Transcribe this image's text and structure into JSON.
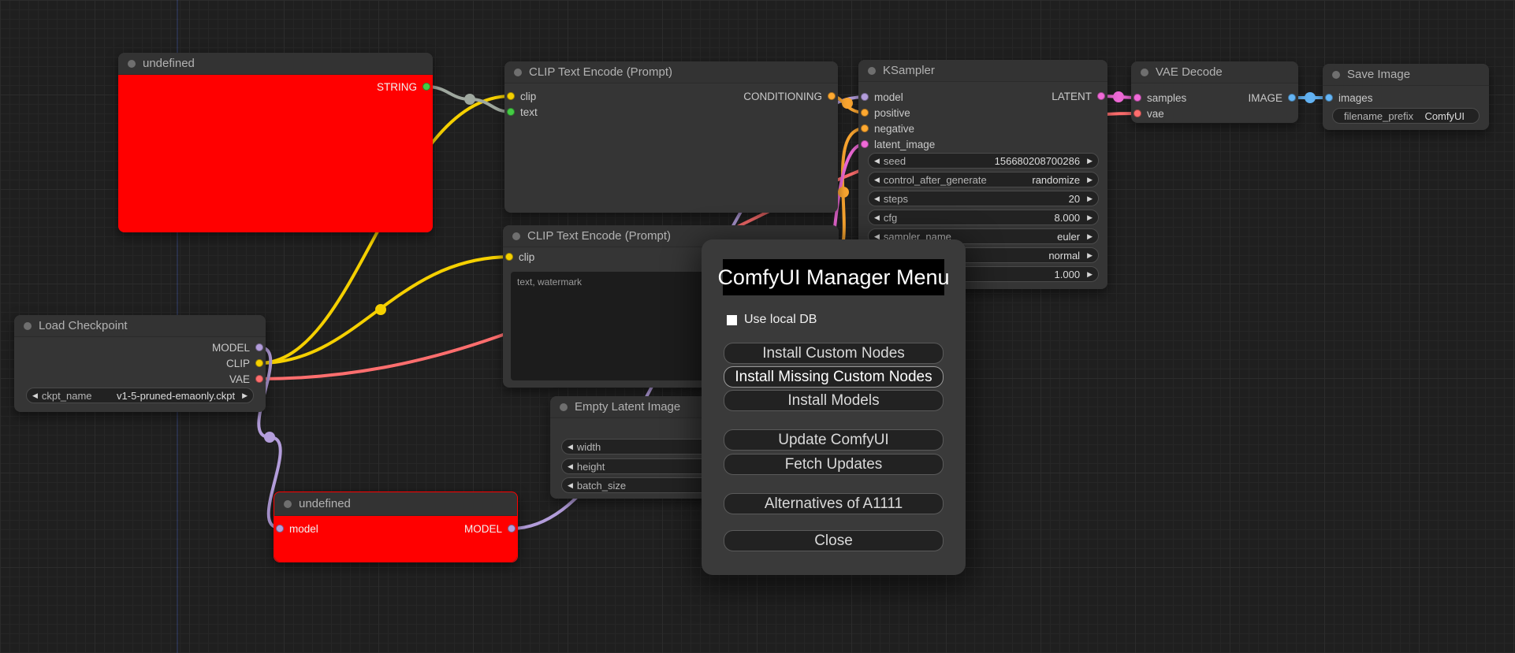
{
  "type_colors": {
    "MODEL": "#b39ddb",
    "CLIP": "#f5d000",
    "VAE": "#ff6e6e",
    "CONDITIONING": "#ffa931",
    "LATENT": "#f06ad8",
    "IMAGE": "#64b5f6",
    "STRING": "#44cc44",
    "REROUTE": "#9fa89f"
  },
  "nodes": {
    "undefined1": {
      "title": "undefined",
      "output_label": "STRING"
    },
    "clip1": {
      "title": "CLIP Text Encode (Prompt)",
      "inputs": [
        "clip",
        "text"
      ],
      "output_label": "CONDITIONING"
    },
    "clip2": {
      "title": "CLIP Text Encode (Prompt)",
      "inputs": [
        "clip"
      ],
      "text_value": "text, watermark"
    },
    "ksampler": {
      "title": "KSampler",
      "inputs": [
        "model",
        "positive",
        "negative",
        "latent_image"
      ],
      "output_label": "LATENT",
      "widgets": [
        {
          "label": "seed",
          "value": "156680208700286"
        },
        {
          "label": "control_after_generate",
          "value": "randomize"
        },
        {
          "label": "steps",
          "value": "20"
        },
        {
          "label": "cfg",
          "value": "8.000"
        },
        {
          "label": "sampler_name",
          "value": "euler"
        },
        {
          "label": "",
          "value": "normal"
        },
        {
          "label": "",
          "value": "1.000"
        }
      ]
    },
    "vae_decode": {
      "title": "VAE Decode",
      "inputs": [
        "samples",
        "vae"
      ],
      "output_label": "IMAGE"
    },
    "save_image": {
      "title": "Save Image",
      "inputs": [
        "images"
      ],
      "widget": {
        "label": "filename_prefix",
        "value": "ComfyUI"
      }
    },
    "load_checkpoint": {
      "title": "Load Checkpoint",
      "outputs": [
        "MODEL",
        "CLIP",
        "VAE"
      ],
      "widget": {
        "label": "ckpt_name",
        "value": "v1-5-pruned-emaonly.ckpt"
      }
    },
    "empty_latent": {
      "title": "Empty Latent Image",
      "widgets": [
        {
          "label": "width"
        },
        {
          "label": "height"
        },
        {
          "label": "batch_size"
        }
      ]
    },
    "undefined2": {
      "title": "undefined",
      "input_label": "model",
      "output_label": "MODEL"
    }
  },
  "dialog": {
    "title": "ComfyUI Manager Menu",
    "checkbox_label": "Use local DB",
    "checkbox_checked": false,
    "buttons": [
      "Install Custom Nodes",
      "Install Missing Custom Nodes",
      "Install Models",
      "Update ComfyUI",
      "Fetch Updates",
      "Alternatives of A1111",
      "Close"
    ]
  }
}
